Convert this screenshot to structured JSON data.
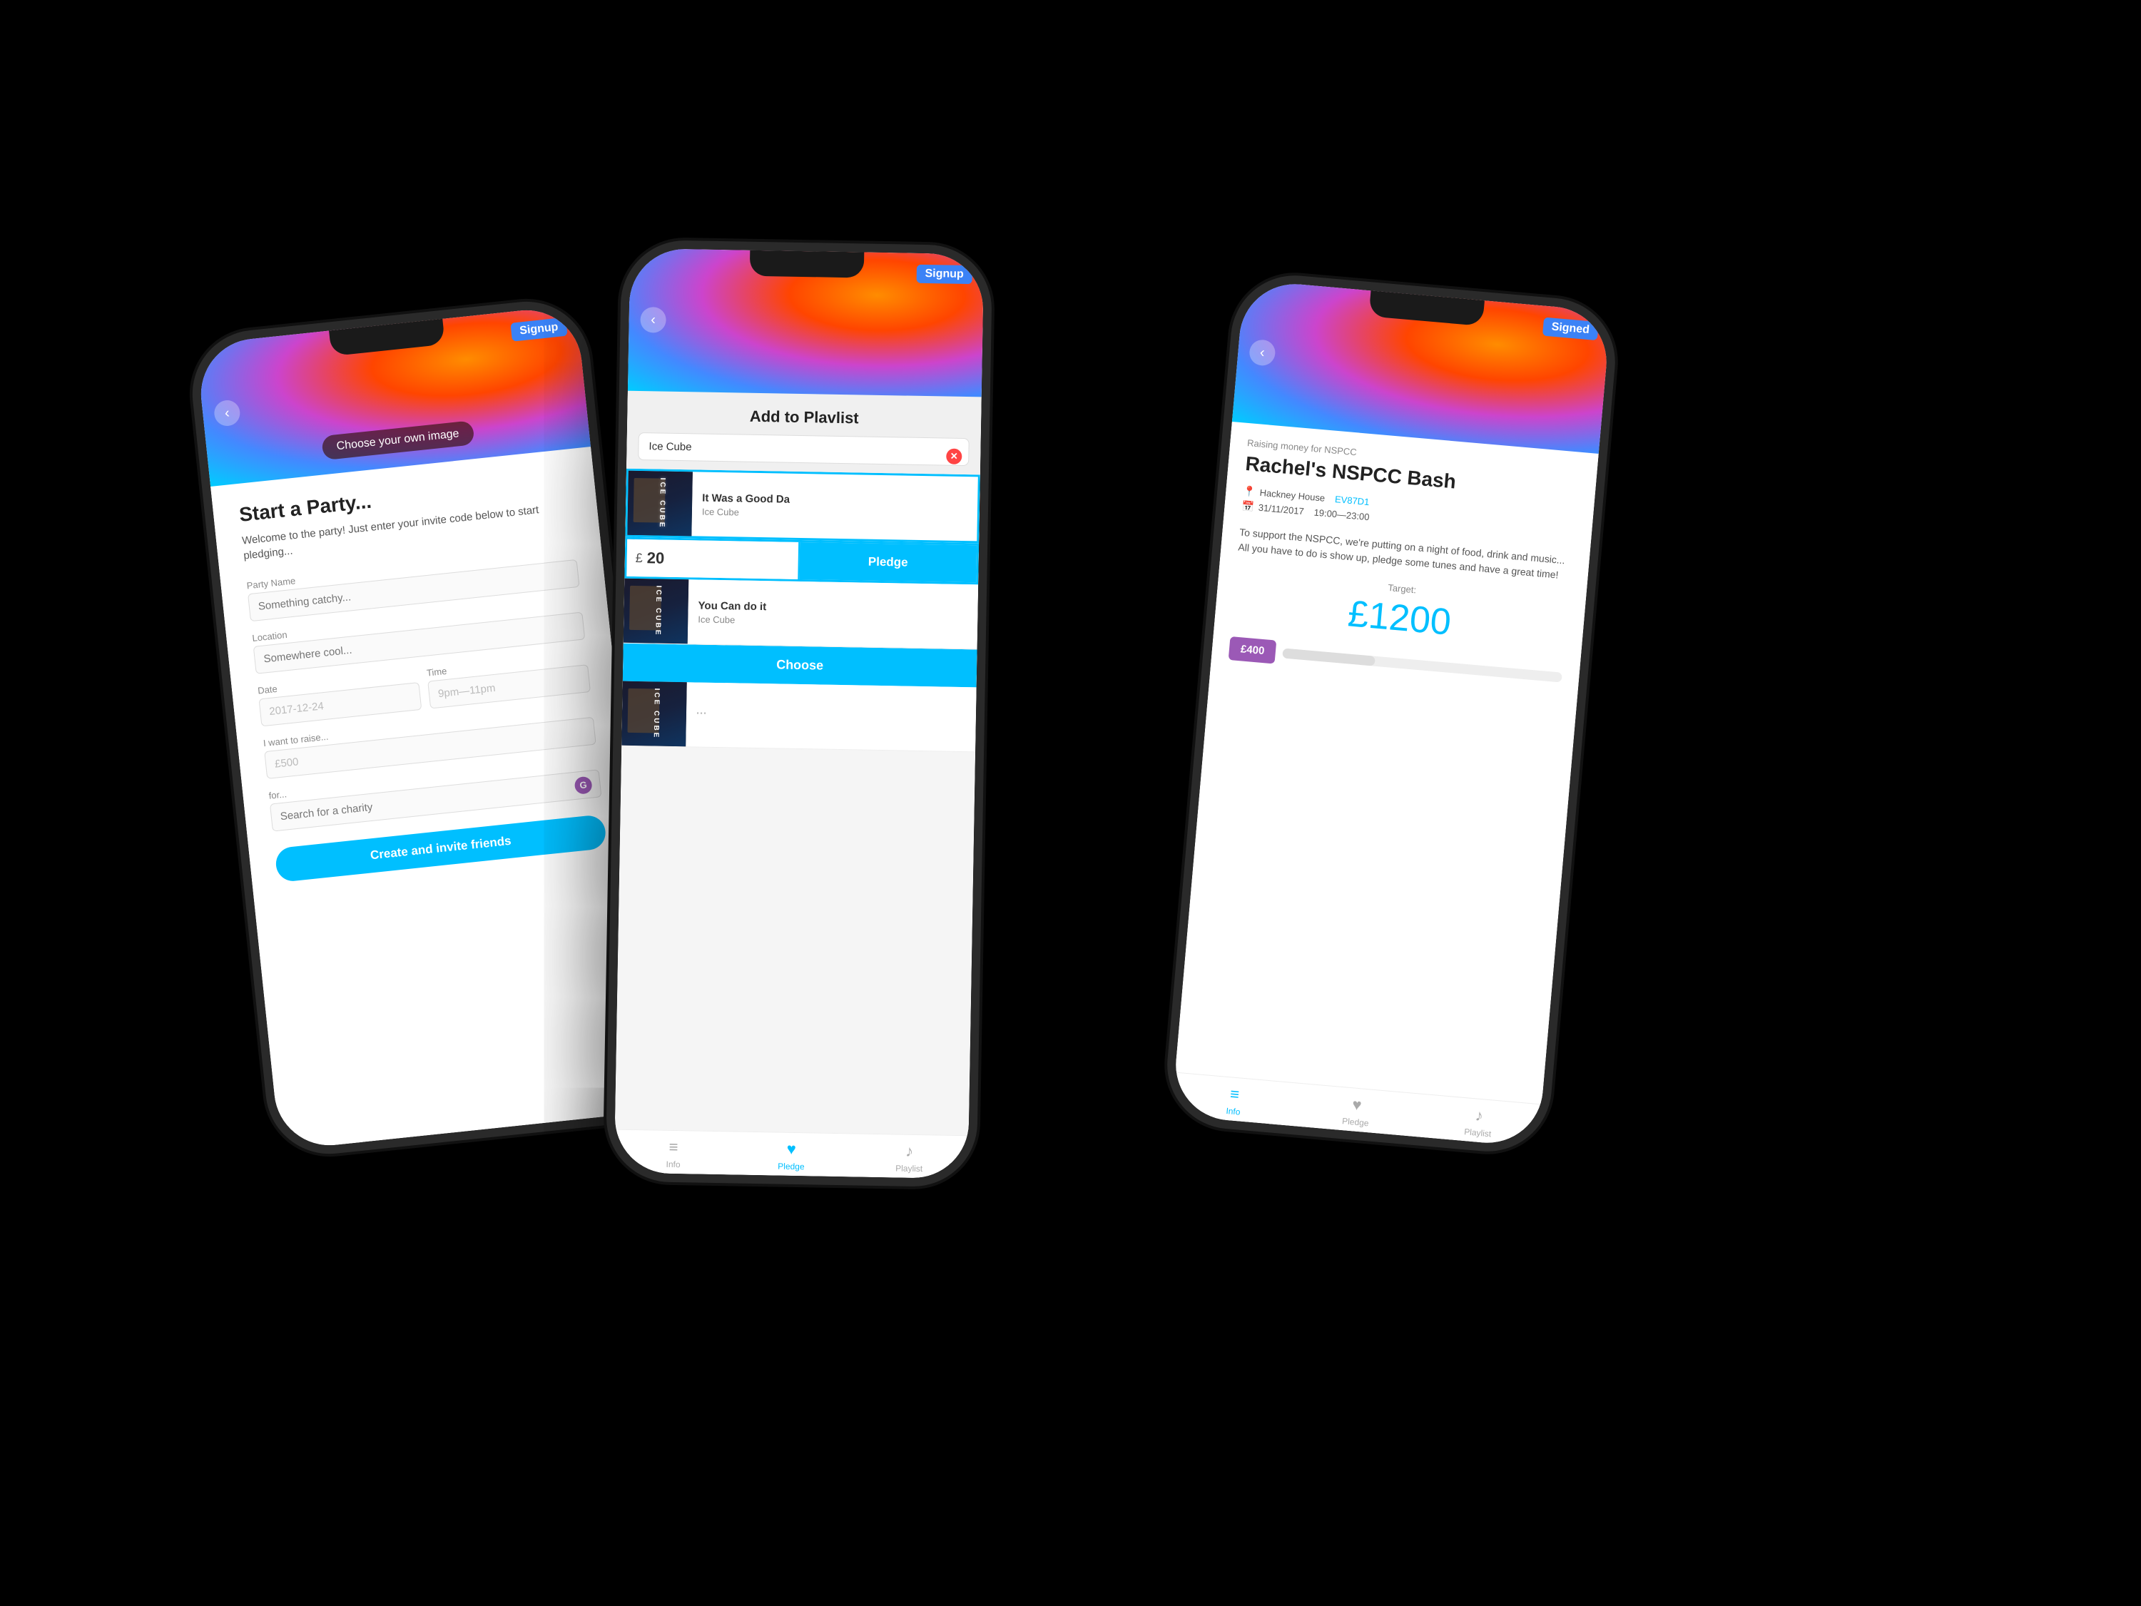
{
  "phones": {
    "left": {
      "badge": "Signup",
      "choose_image_btn": "Choose your own image",
      "title": "Start a Party...",
      "subtitle": "Welcome to the party! Just enter your invite code below to start pledging...",
      "form": {
        "party_name_label": "Party Name",
        "party_name_placeholder": "Something catchy...",
        "location_label": "Location",
        "location_placeholder": "Somewhere cool...",
        "date_label": "Date",
        "date_value": "2017-12-24",
        "time_label": "Time",
        "time_value": "9pm—11pm",
        "raise_label": "I want to raise...",
        "raise_value": "£500",
        "charity_label": "for...",
        "charity_placeholder": "Search for a charity",
        "create_btn": "Create and invite friends"
      }
    },
    "center": {
      "badge": "Signup",
      "title": "Add to Plavlist",
      "search_value": "Ice Cube",
      "songs": [
        {
          "title": "It Was a Good Da",
          "artist": "Ice Cube",
          "selected": true,
          "pledge_amount": "20",
          "pledge_btn": "Pledge"
        },
        {
          "title": "You Can do it",
          "artist": "Ice Cube",
          "selected": false
        }
      ],
      "choose_btn": "Choose",
      "nav": {
        "info": "Info",
        "pledge": "Pledge",
        "playlist": "Playlist"
      }
    },
    "right": {
      "badge": "Signed",
      "raising_for": "Raising money for NSPCC",
      "title": "Rachel's NSPCC Bash",
      "location": "Hackney House",
      "event_code": "EV87D1",
      "date": "31/11/2017",
      "time": "19:00—23:00",
      "description": "To support the NSPCC, we're putting on a night of food, drink and music... All you have to do is show up, pledge some tunes and have a great time!",
      "target_label": "Target:",
      "target_amount": "£1200",
      "raised_amount": "£400",
      "progress_percent": 33,
      "nav": {
        "info": "Info",
        "pledge": "Pledge",
        "playlist": "Playlist"
      }
    }
  }
}
